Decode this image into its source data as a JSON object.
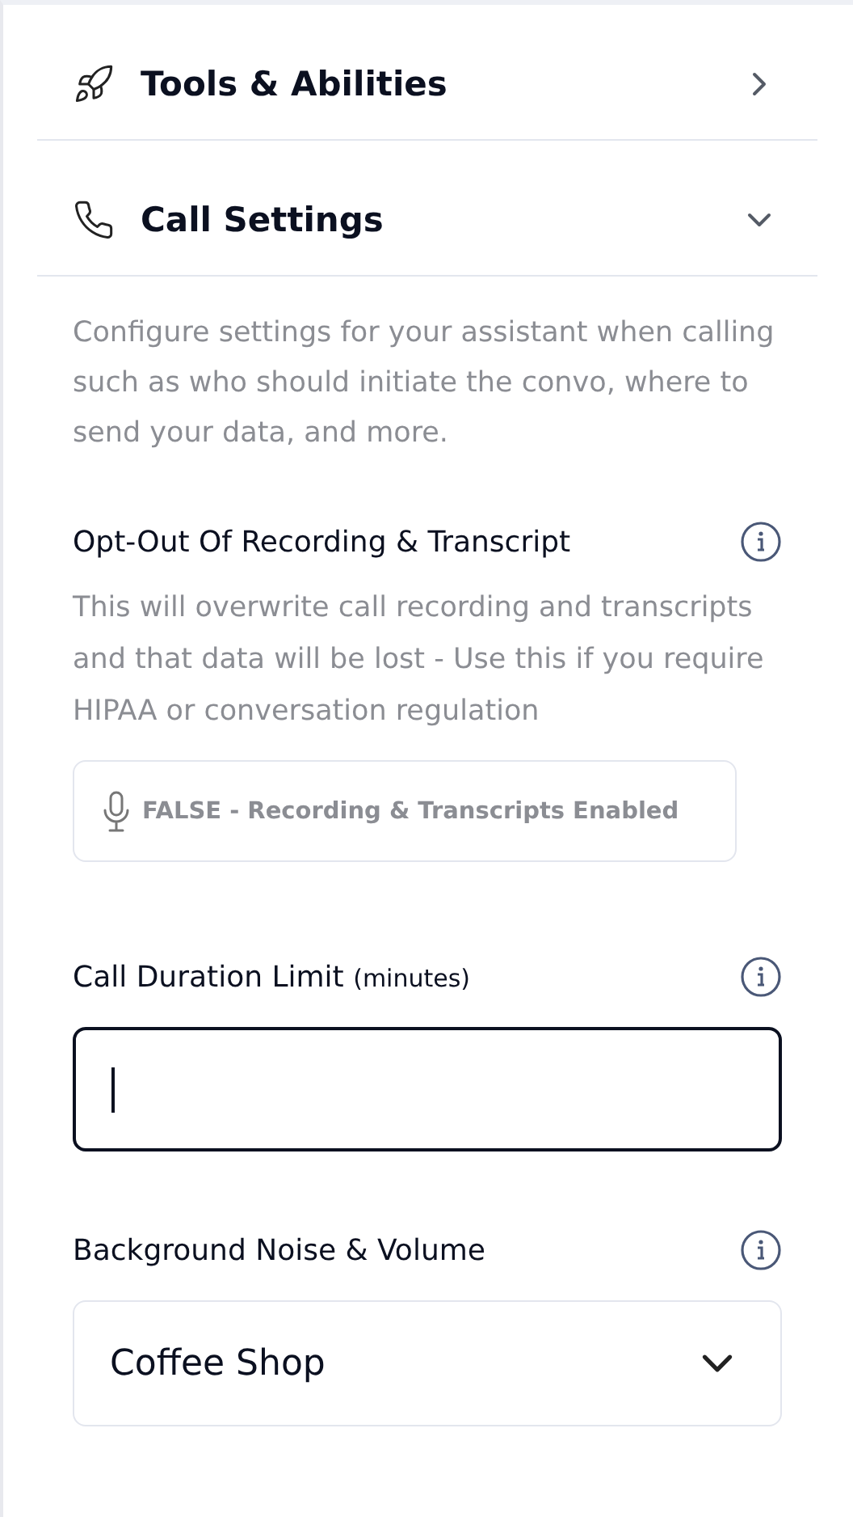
{
  "sections": [
    {
      "title": "Tools & Abilities",
      "expanded": false
    },
    {
      "title": "Call Settings",
      "expanded": true,
      "description": "Configure settings for your assistant when calling such as who should initiate the convo, where to send your data, and more.",
      "fields": [
        {
          "kind": "toggle",
          "label": "Opt-Out Of Recording & Transcript",
          "help": "This will overwrite call recording and transcripts and that data will be lost - Use this if you require HIPAA or conversation regulation",
          "value": "FALSE - Recording & Transcripts Enabled",
          "on": false
        },
        {
          "kind": "number",
          "label": "Call Duration Limit",
          "unit": "(minutes)",
          "focused": true
        },
        {
          "kind": "select",
          "label": "Background Noise & Volume",
          "value": "Coffee Shop"
        }
      ]
    }
  ]
}
